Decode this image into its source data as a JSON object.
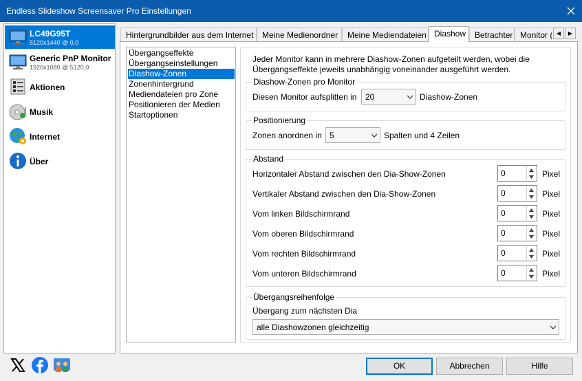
{
  "window": {
    "title": "Endless Slideshow Screensaver Pro Einstellungen"
  },
  "left_items": [
    {
      "label": "LC49G95T",
      "sub": "5120x1440 @ 0,0",
      "icon": "monitor-icon"
    },
    {
      "label": "Generic PnP Monitor",
      "sub": "1920x1080 @ 5120,0",
      "icon": "monitor-icon"
    },
    {
      "label": "Aktionen",
      "icon": "actions-icon"
    },
    {
      "label": "Musik",
      "icon": "music-icon"
    },
    {
      "label": "Internet",
      "icon": "internet-icon"
    },
    {
      "label": "Über",
      "icon": "info-icon"
    }
  ],
  "tabs": [
    "Hintergrundbilder aus dem Internet",
    "Meine Medienordner",
    "Meine Mediendateien",
    "Diashow",
    "Betrachter",
    "Monitor (("
  ],
  "nav": [
    "Übergangseffekte",
    "Übergangseinstellungen",
    "Diashow-Zonen",
    "Zonenhintergrund",
    "Mediendateien pro Zone",
    "Positionieren der Medien",
    "Startoptionen"
  ],
  "description": "Jeder Monitor kann in mehrere Diashow-Zonen aufgeteilt werden, wobei die Übergangseffekte jeweils unabhängig voneinander ausgeführt werden.",
  "zones": {
    "group": "Diashow-Zonen pro Monitor",
    "label": "Diesen Monitor aufsplitten in",
    "value": "20",
    "suffix": "Diashow-Zonen"
  },
  "position": {
    "group": "Positionierung",
    "label": "Zonen anordnen in",
    "value": "5",
    "suffix": "Spalten und 4 Zeilen"
  },
  "spacing": {
    "group": "Abstand",
    "unit": "Pixel",
    "rows": [
      {
        "label": "Horizontaler Abstand zwischen den Dia-Show-Zonen",
        "value": "0"
      },
      {
        "label": "Vertikaler Abstand zwischen den Dia-Show-Zonen",
        "value": "0"
      },
      {
        "label": "Vom linken Bildschirmrand",
        "value": "0"
      },
      {
        "label": "Vom oberen Bildschirmrand",
        "value": "0"
      },
      {
        "label": "Vom rechten Bildschirmrand",
        "value": "0"
      },
      {
        "label": "Vom unteren Bildschirmrand",
        "value": "0"
      }
    ]
  },
  "order": {
    "group": "Übergangsreihenfolge",
    "label": "Übergang zum nächsten Dia",
    "value": "alle Diashowzonen gleichzeitig"
  },
  "buttons": {
    "ok": "OK",
    "cancel": "Abbrechen",
    "help": "Hilfe"
  },
  "colors": {
    "titlebar": "#0b5cad",
    "selection": "#0078d7"
  }
}
